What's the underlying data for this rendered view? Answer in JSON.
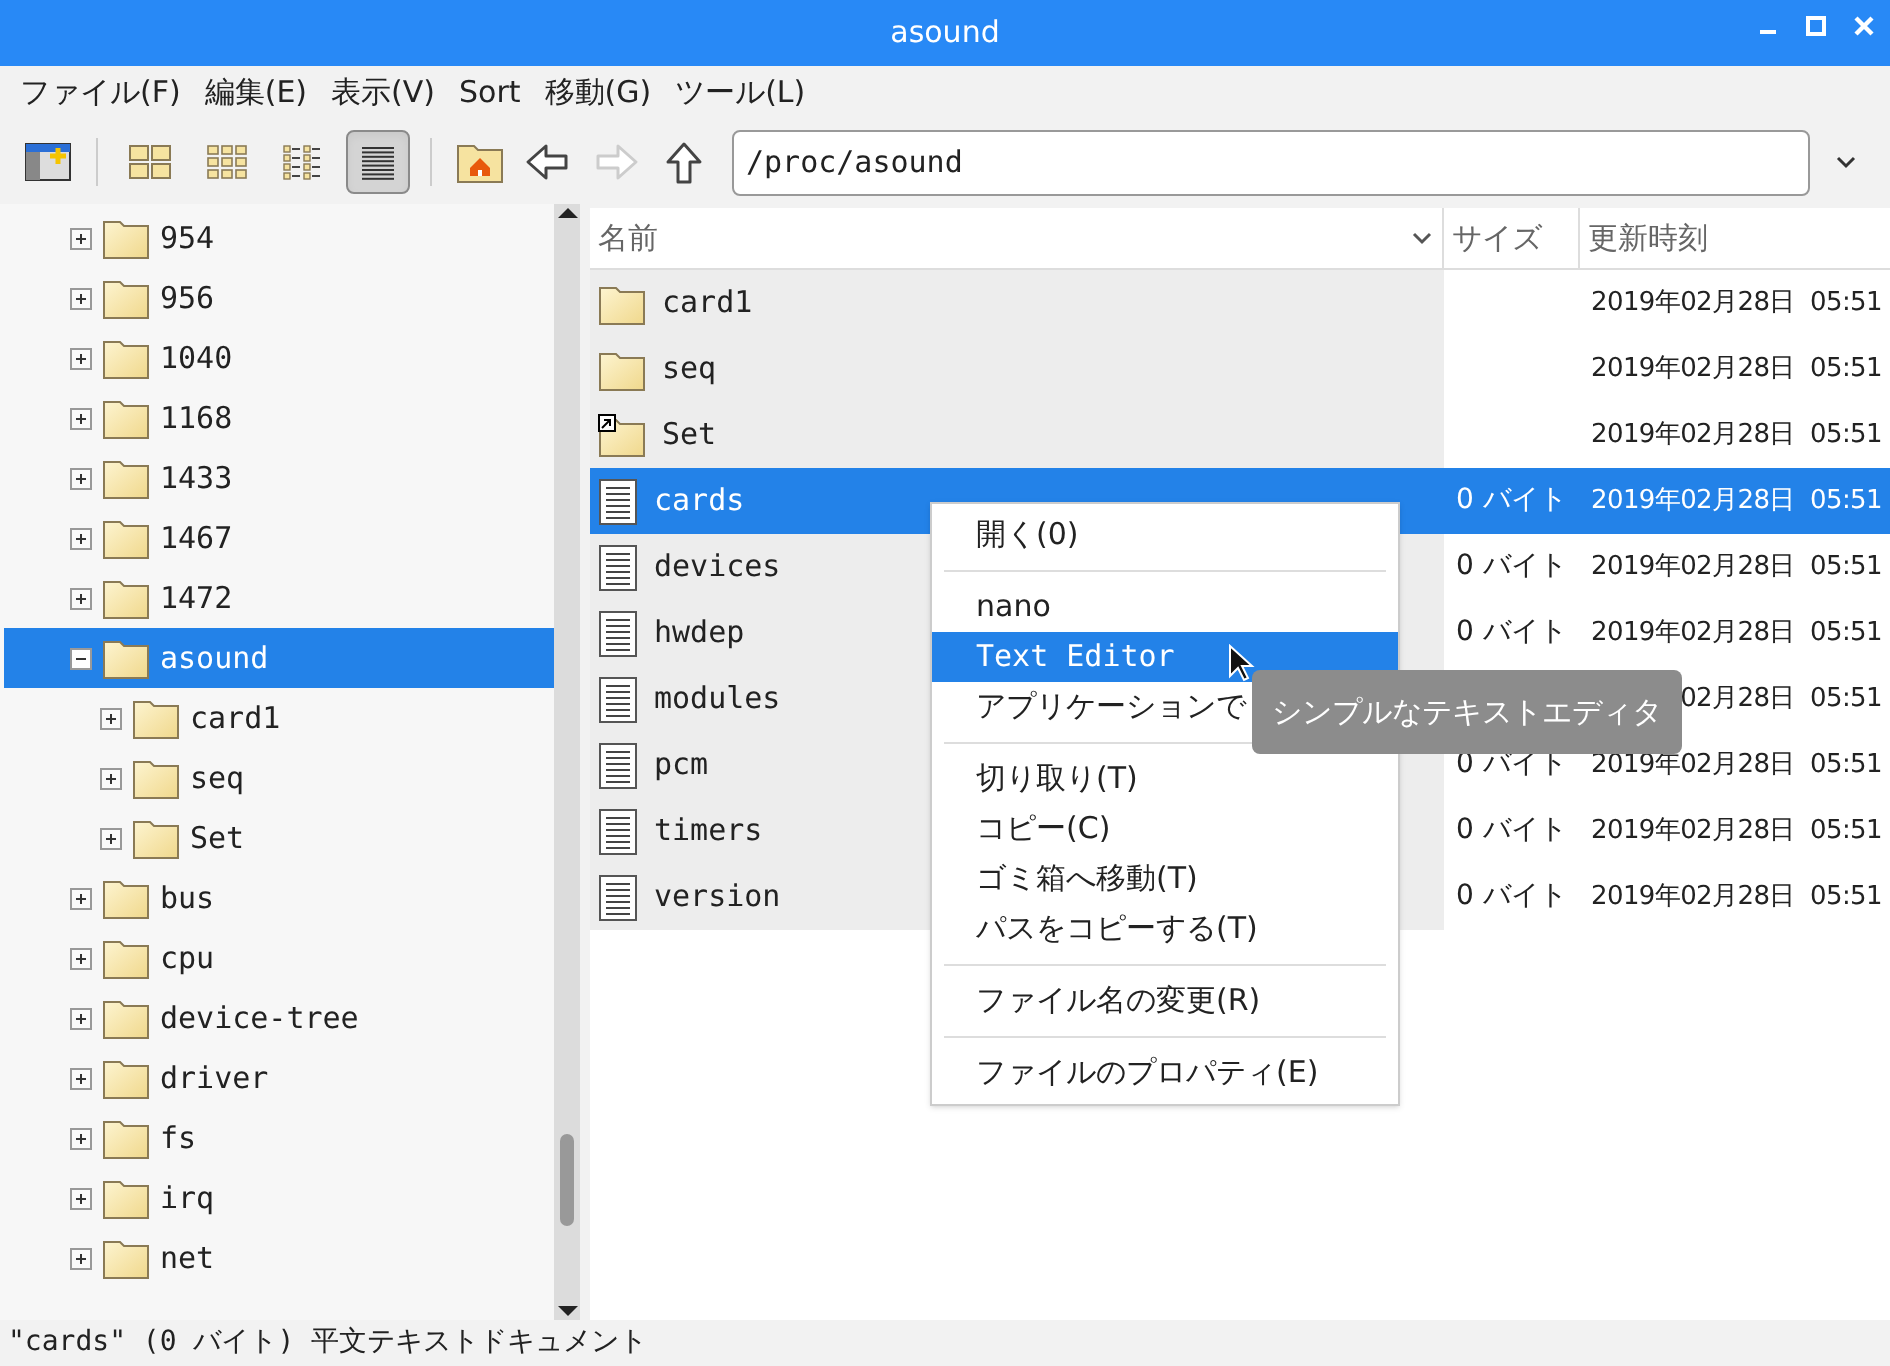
{
  "window": {
    "title": "asound"
  },
  "menu_bar": [
    "ファイル(F)",
    "編集(E)",
    "表示(V)",
    "Sort",
    "移動(G)",
    "ツール(L)"
  ],
  "toolbar": [
    {
      "kind": "new-window"
    },
    {
      "kind": "icons",
      "selected": false
    },
    {
      "kind": "thumbnails",
      "selected": false
    },
    {
      "kind": "compact",
      "selected": false
    },
    {
      "kind": "details",
      "selected": true
    },
    {
      "kind": "home"
    },
    {
      "kind": "back",
      "disabled": false
    },
    {
      "kind": "forward",
      "disabled": true
    },
    {
      "kind": "up",
      "disabled": false
    }
  ],
  "path_field": {
    "value": "/proc/asound"
  },
  "tree": [
    {
      "label": "954",
      "expanded": false,
      "selected": false
    },
    {
      "label": "956",
      "expanded": false,
      "selected": false
    },
    {
      "label": "1040",
      "expanded": false,
      "selected": false
    },
    {
      "label": "1168",
      "expanded": false,
      "selected": false
    },
    {
      "label": "1433",
      "expanded": false,
      "selected": false
    },
    {
      "label": "1467",
      "expanded": false,
      "selected": false
    },
    {
      "label": "1472",
      "expanded": false,
      "selected": false
    },
    {
      "label": "asound",
      "expanded": true,
      "selected": true,
      "children": [
        {
          "label": "card1",
          "expanded": false,
          "selected": false
        },
        {
          "label": "seq",
          "expanded": false,
          "selected": false
        },
        {
          "label": "Set",
          "expanded": false,
          "selected": false
        }
      ]
    },
    {
      "label": "bus",
      "expanded": false,
      "selected": false
    },
    {
      "label": "cpu",
      "expanded": false,
      "selected": false
    },
    {
      "label": "device-tree",
      "expanded": false,
      "selected": false
    },
    {
      "label": "driver",
      "expanded": false,
      "selected": false
    },
    {
      "label": "fs",
      "expanded": false,
      "selected": false
    },
    {
      "label": "irq",
      "expanded": false,
      "selected": false
    },
    {
      "label": "net",
      "expanded": false,
      "selected": false
    }
  ],
  "file_list": {
    "columns": [
      "名前",
      "サイズ",
      "更新時刻"
    ],
    "rows": [
      {
        "kind": "folder",
        "name": "card1",
        "size": "",
        "modified": "2019年02月28日  05:51",
        "selected": false
      },
      {
        "kind": "folder",
        "name": "seq",
        "size": "",
        "modified": "2019年02月28日  05:51",
        "selected": false
      },
      {
        "kind": "link",
        "name": "Set",
        "size": "",
        "modified": "2019年02月28日  05:51",
        "selected": false
      },
      {
        "kind": "file",
        "name": "cards",
        "size": "0 バイト",
        "modified": "2019年02月28日  05:51",
        "selected": true
      },
      {
        "kind": "file",
        "name": "devices",
        "size": "0 バイト",
        "modified": "2019年02月28日  05:51",
        "selected": false
      },
      {
        "kind": "file",
        "name": "hwdep",
        "size": "0 バイト",
        "modified": "2019年02月28日  05:51",
        "selected": false
      },
      {
        "kind": "file",
        "name": "modules",
        "size": "",
        "modified": "02月28日  05:51",
        "selected": false
      },
      {
        "kind": "file",
        "name": "pcm",
        "size": "0 バイト",
        "modified": "2019年02月28日  05:51",
        "selected": false
      },
      {
        "kind": "file",
        "name": "timers",
        "size": "0 バイト",
        "modified": "2019年02月28日  05:51",
        "selected": false
      },
      {
        "kind": "file",
        "name": "version",
        "size": "0 バイト",
        "modified": "2019年02月28日  05:51",
        "selected": false
      }
    ]
  },
  "context_menu": [
    {
      "kind": "item",
      "label": "開く(0)",
      "selected": false
    },
    {
      "kind": "separator"
    },
    {
      "kind": "item",
      "label": "nano",
      "selected": false
    },
    {
      "kind": "item",
      "label": "Text Editor",
      "selected": true
    },
    {
      "kind": "item",
      "label": "アプリケーションで",
      "selected": false
    },
    {
      "kind": "separator"
    },
    {
      "kind": "item",
      "label": "切り取り(T)",
      "selected": false
    },
    {
      "kind": "item",
      "label": "コピー(C)",
      "selected": false
    },
    {
      "kind": "item",
      "label": "ゴミ箱へ移動(T)",
      "selected": false
    },
    {
      "kind": "item",
      "label": "パスをコピーする(T)",
      "selected": false
    },
    {
      "kind": "separator"
    },
    {
      "kind": "item",
      "label": "ファイル名の変更(R)",
      "selected": false
    },
    {
      "kind": "separator"
    },
    {
      "kind": "item",
      "label": "ファイルのプロパティ(E)",
      "selected": false
    }
  ],
  "tooltip": {
    "text": "シンプルなテキストエディタ"
  },
  "status_bar": {
    "text": "\"cards\" (0 バイト) 平文テキストドキュメント"
  }
}
